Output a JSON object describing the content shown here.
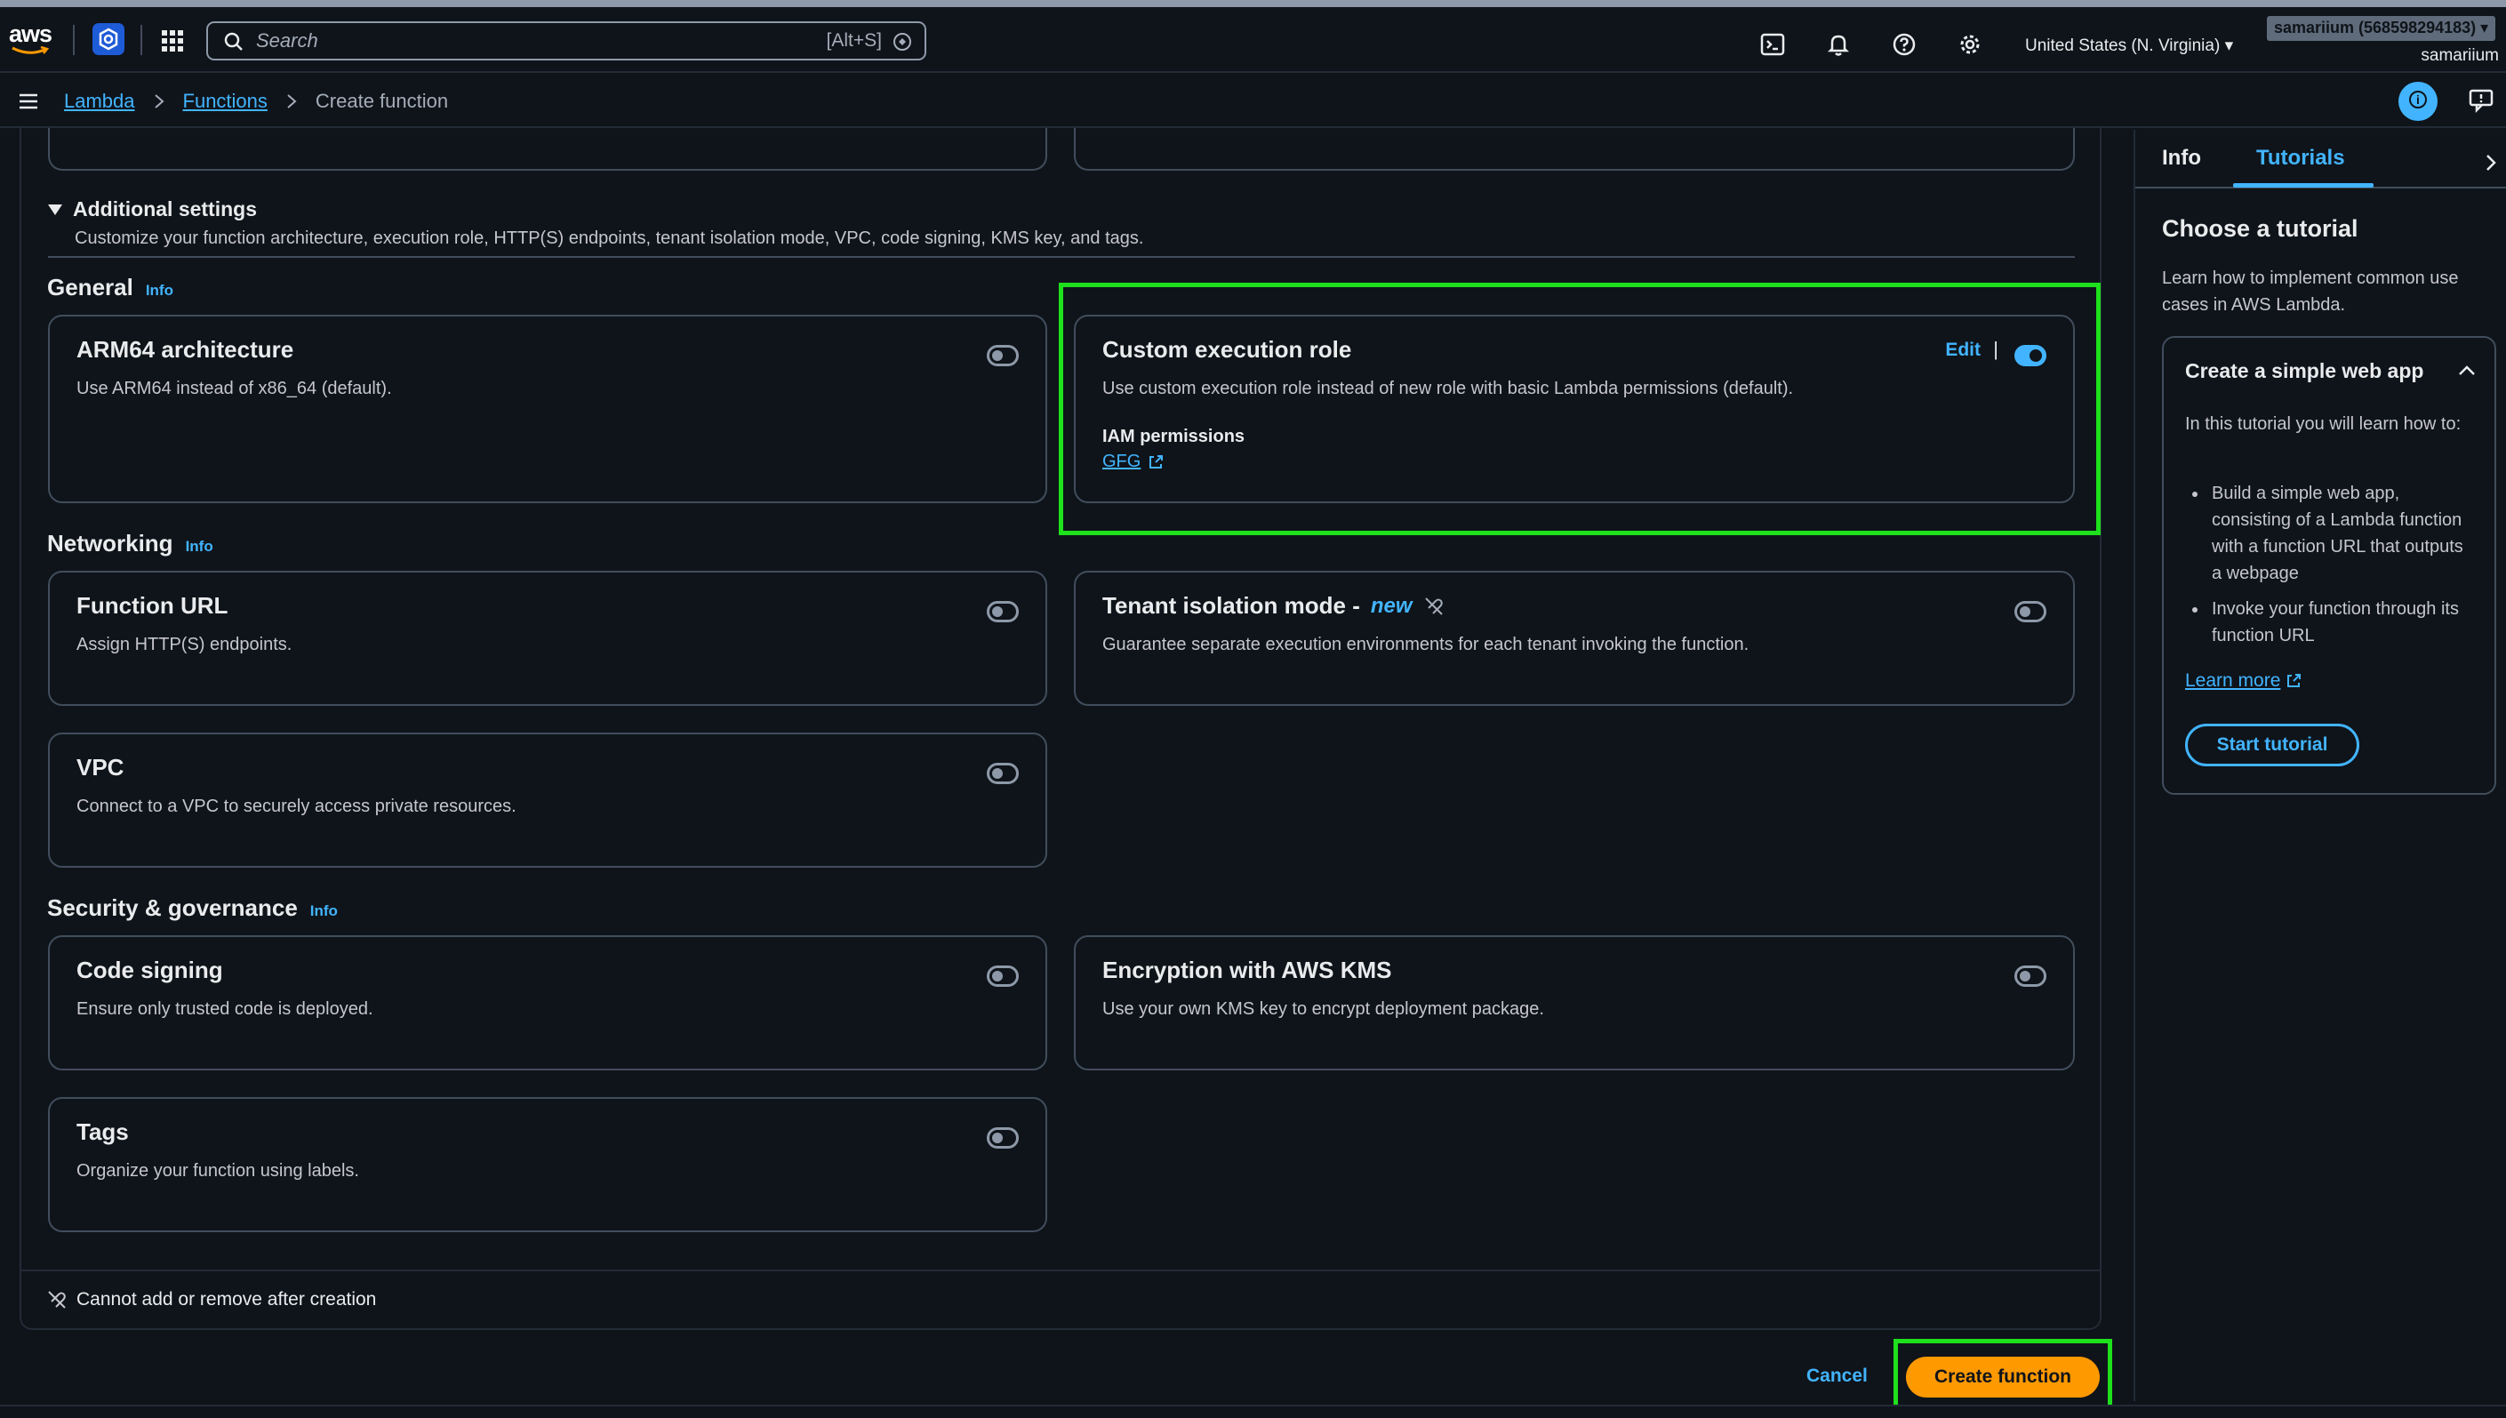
{
  "topnav": {
    "logo_text": "aws",
    "search_placeholder": "Search",
    "search_shortcut": "[Alt+S]",
    "region": "United States (N. Virginia) ▾",
    "account_badge": "samariium (568598294183) ▾",
    "username": "samariium"
  },
  "breadcrumb": {
    "items": [
      "Lambda",
      "Functions"
    ],
    "current": "Create function"
  },
  "additional_settings": {
    "title": "Additional settings",
    "description": "Customize your function architecture, execution role, HTTP(S) endpoints, tenant isolation mode, VPC, code signing, KMS key, and tags."
  },
  "sections": {
    "general": {
      "title": "General",
      "info": "Info"
    },
    "networking": {
      "title": "Networking",
      "info": "Info"
    },
    "security": {
      "title": "Security & governance",
      "info": "Info"
    }
  },
  "cards": {
    "arm64": {
      "title": "ARM64 architecture",
      "desc": "Use ARM64 instead of x86_64 (default).",
      "enabled": false
    },
    "custom_role": {
      "title": "Custom execution role",
      "desc": "Use custom execution role instead of new role with basic Lambda permissions (default).",
      "edit": "Edit",
      "separator": "|",
      "iam_label": "IAM permissions",
      "iam_link": "GFG",
      "enabled": true
    },
    "function_url": {
      "title": "Function URL",
      "desc": "Assign HTTP(S) endpoints.",
      "enabled": false
    },
    "tenant": {
      "title": "Tenant isolation mode -",
      "new_tag": "new",
      "desc": "Guarantee separate execution environments for each tenant invoking the function.",
      "enabled": false
    },
    "vpc": {
      "title": "VPC",
      "desc": "Connect to a VPC to securely access private resources.",
      "enabled": false
    },
    "code_signing": {
      "title": "Code signing",
      "desc": "Ensure only trusted code is deployed.",
      "enabled": false
    },
    "kms": {
      "title": "Encryption with AWS KMS",
      "desc": "Use your own KMS key to encrypt deployment package.",
      "enabled": false
    },
    "tags": {
      "title": "Tags",
      "desc": "Organize your function using labels.",
      "enabled": false
    }
  },
  "footer_note": "Cannot add or remove after creation",
  "actions": {
    "cancel": "Cancel",
    "create": "Create function"
  },
  "tools_panel": {
    "tabs": [
      "Info",
      "Tutorials"
    ],
    "active_tab": "Tutorials",
    "heading": "Choose a tutorial",
    "lead": "Learn how to implement common use cases in AWS Lambda.",
    "tutorial": {
      "title": "Create a simple web app",
      "intro": "In this tutorial you will learn how to:",
      "bullets": [
        "Build a simple web app, consisting of a Lambda function with a function URL that outputs a webpage",
        "Invoke your function through its function URL"
      ],
      "learn_more": "Learn more",
      "start": "Start tutorial"
    }
  },
  "colors": {
    "background": "#0f141a",
    "accent_link": "#42b4ff",
    "primary_button": "#ff9900",
    "highlight_box": "#1ee01c",
    "border": "#414d5c"
  }
}
